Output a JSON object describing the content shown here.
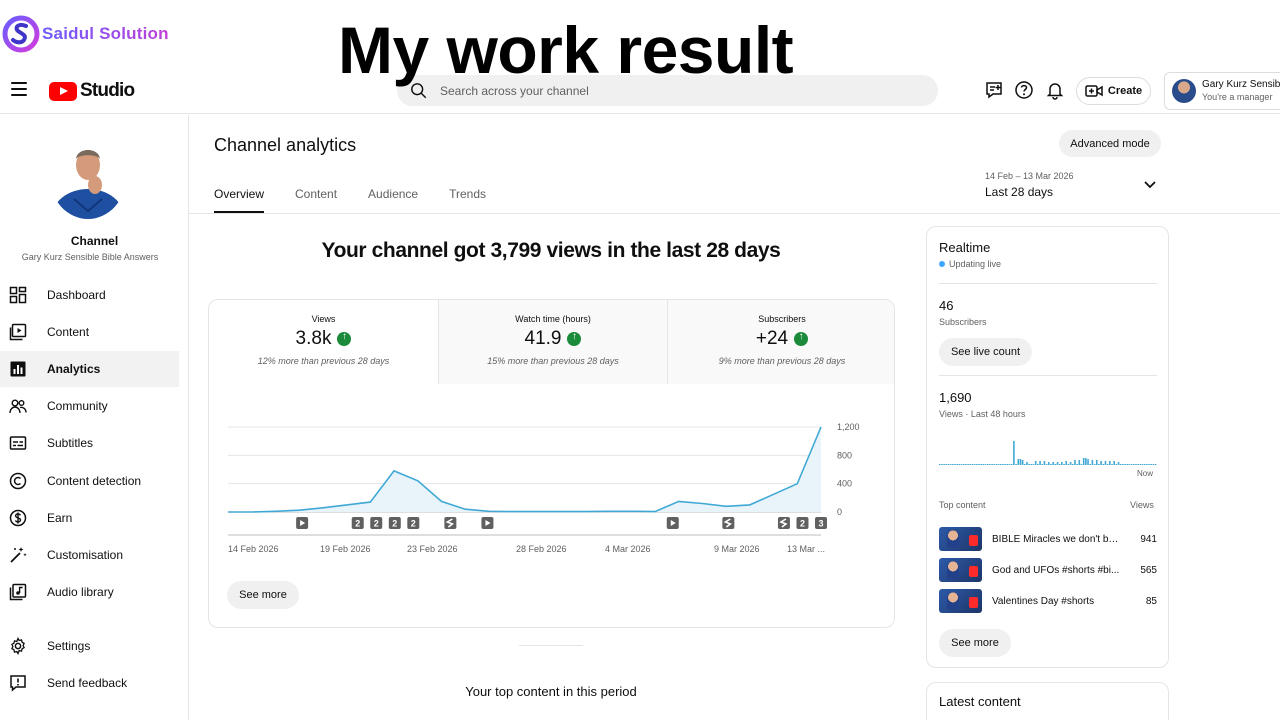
{
  "watermark": {
    "brand": "Saidul Solution",
    "overlay_title": "My work result"
  },
  "header": {
    "app_name": "Studio",
    "search_placeholder": "Search across your channel",
    "create_label": "Create",
    "account_name": "Gary Kurz Sensible Bible Answers",
    "account_role": "You're a manager"
  },
  "sidebar": {
    "channel_label": "Channel",
    "channel_name": "Gary Kurz Sensible Bible Answers",
    "items": [
      {
        "label": "Dashboard",
        "icon": "dashboard-icon"
      },
      {
        "label": "Content",
        "icon": "content-icon"
      },
      {
        "label": "Analytics",
        "icon": "analytics-icon",
        "active": true
      },
      {
        "label": "Community",
        "icon": "community-icon"
      },
      {
        "label": "Subtitles",
        "icon": "subtitles-icon"
      },
      {
        "label": "Content detection",
        "icon": "copyright-icon"
      },
      {
        "label": "Earn",
        "icon": "dollar-icon"
      },
      {
        "label": "Customisation",
        "icon": "magic-wand-icon"
      },
      {
        "label": "Audio library",
        "icon": "audio-library-icon"
      },
      {
        "label": "Settings",
        "icon": "gear-icon"
      },
      {
        "label": "Send feedback",
        "icon": "feedback-icon"
      }
    ]
  },
  "main": {
    "title": "Channel analytics",
    "advanced_mode": "Advanced mode",
    "tabs": [
      {
        "label": "Overview",
        "active": true
      },
      {
        "label": "Content"
      },
      {
        "label": "Audience"
      },
      {
        "label": "Trends"
      }
    ],
    "date_range": {
      "dates": "14 Feb – 13 Mar 2026",
      "label": "Last 28 days"
    },
    "headline": "Your channel got 3,799 views in the last 28 days",
    "metrics": [
      {
        "label": "Views",
        "value": "3.8k",
        "note": "12% more than previous 28 days"
      },
      {
        "label": "Watch time (hours)",
        "value": "41.9",
        "note": "15% more than previous 28 days"
      },
      {
        "label": "Subscribers",
        "value": "+24",
        "note": "9% more than previous 28 days"
      }
    ],
    "see_more": "See more",
    "top_content_title": "Your top content in this period"
  },
  "chart_data": {
    "type": "area",
    "x_tick_labels": [
      "14 Feb 2026",
      "19 Feb 2026",
      "23 Feb 2026",
      "28 Feb 2026",
      "4 Mar 2026",
      "9 Mar 2026",
      "13 Mar ..."
    ],
    "y_tick_labels": [
      "0",
      "400",
      "800",
      "1,200"
    ],
    "ylim": [
      0,
      1200
    ],
    "values": [
      0,
      0,
      10,
      25,
      60,
      100,
      140,
      580,
      440,
      150,
      40,
      10,
      5,
      5,
      5,
      5,
      10,
      10,
      5,
      150,
      120,
      80,
      100,
      250,
      400,
      1200
    ],
    "color": "#41a8d5",
    "markers": [
      "",
      "",
      "",
      "",
      "video",
      "",
      "",
      "2",
      "2",
      "2",
      "2",
      "",
      "shorts",
      "",
      "video",
      "",
      "",
      "",
      "",
      "",
      "",
      "",
      "",
      "",
      "video",
      "",
      "",
      "shorts",
      "",
      "",
      "shorts",
      "2",
      "3"
    ]
  },
  "realtime": {
    "title": "Realtime",
    "status": "Updating live",
    "subscribers_value": "46",
    "subscribers_label": "Subscribers",
    "see_live_count": "See live count",
    "views_value": "1,690",
    "views_label": "Views · Last 48 hours",
    "now_label": "Now",
    "bars": [
      3,
      3,
      3,
      3,
      3,
      3,
      3,
      3,
      3,
      3,
      3,
      3,
      3,
      3,
      3,
      3,
      3,
      3,
      3,
      3,
      3,
      3,
      3,
      3,
      3,
      3,
      3,
      3,
      3,
      3,
      3,
      3,
      3,
      3,
      3,
      3,
      3,
      3,
      3,
      3,
      3,
      3,
      3,
      3,
      3,
      3,
      3,
      3,
      3,
      3,
      3,
      3,
      3,
      3,
      3,
      3,
      3,
      3,
      3,
      3,
      3,
      3,
      3,
      3,
      3,
      3,
      3,
      3,
      3,
      3,
      3,
      3,
      3,
      3,
      3,
      3,
      3,
      3,
      3,
      3,
      3,
      3,
      3,
      3,
      3,
      3,
      3,
      3,
      3,
      3,
      3,
      3,
      3,
      3,
      3,
      3,
      3,
      3,
      3,
      3
    ],
    "top_content_label": "Top content",
    "views_column_label": "Views",
    "top_items": [
      {
        "title": "BIBLE Miracles we don't be...",
        "views": "941"
      },
      {
        "title": "God and UFOs #shorts #bi...",
        "views": "565"
      },
      {
        "title": "Valentines Day #shorts",
        "views": "85"
      }
    ],
    "see_more": "See more"
  },
  "latest": {
    "title": "Latest content"
  }
}
